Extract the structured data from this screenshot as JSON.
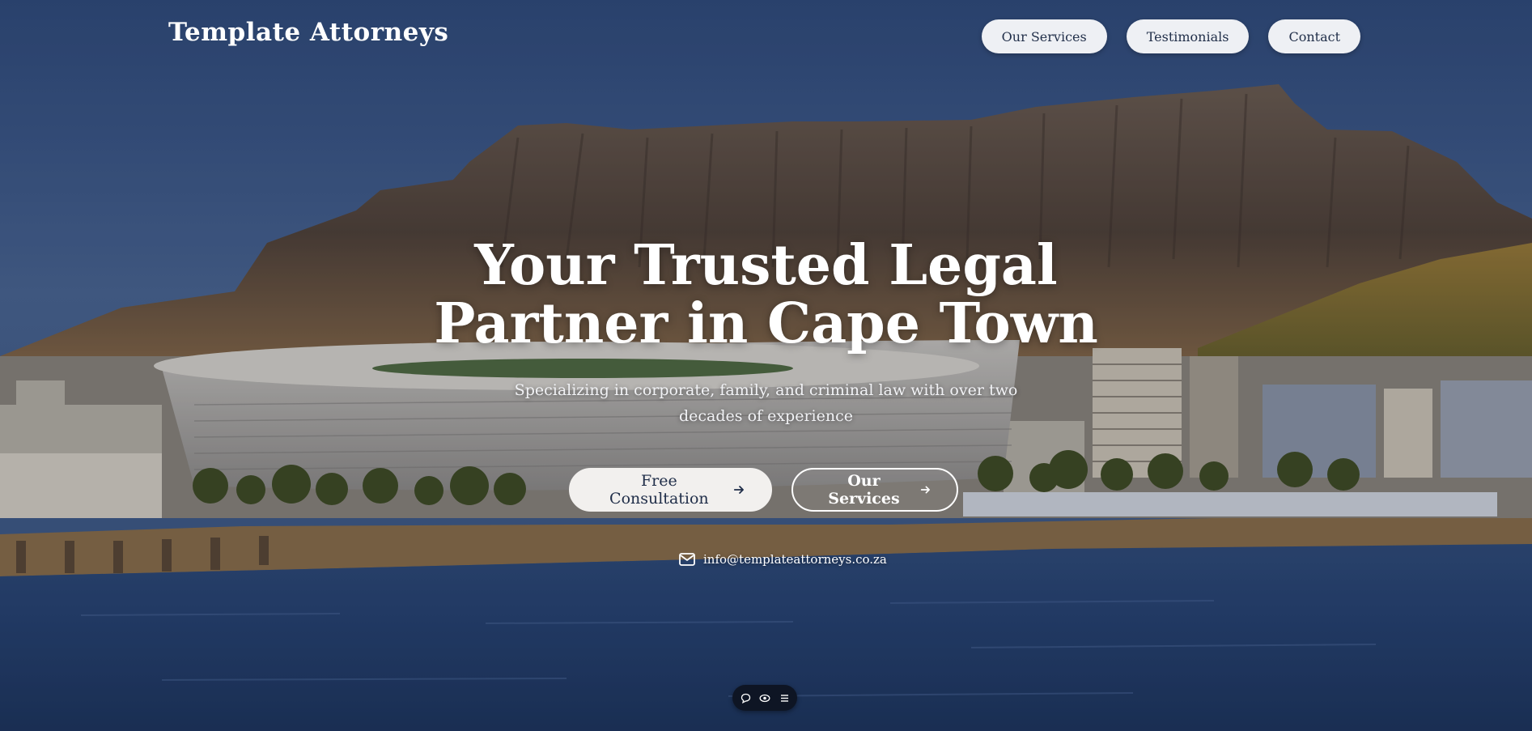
{
  "brand": {
    "name": "Template Attorneys"
  },
  "nav": {
    "items": [
      {
        "label": "Our Services"
      },
      {
        "label": "Testimonials"
      },
      {
        "label": "Contact"
      }
    ]
  },
  "hero": {
    "headline_line1": "Your Trusted Legal",
    "headline_line2": "Partner in Cape Town",
    "subheading": "Specializing in corporate, family, and criminal law with over two decades of experience",
    "primary_cta": "Free Consultation",
    "secondary_cta": "Our Services",
    "email": "info@templateattorneys.co.za"
  },
  "toolbar": {
    "icons": [
      "chat-icon",
      "eye-icon",
      "menu-icon"
    ]
  },
  "colors": {
    "sky": "#3a5684",
    "button_bg": "#eef0f4",
    "button_text": "#22304a",
    "toolbar_bg": "#0e1524"
  }
}
